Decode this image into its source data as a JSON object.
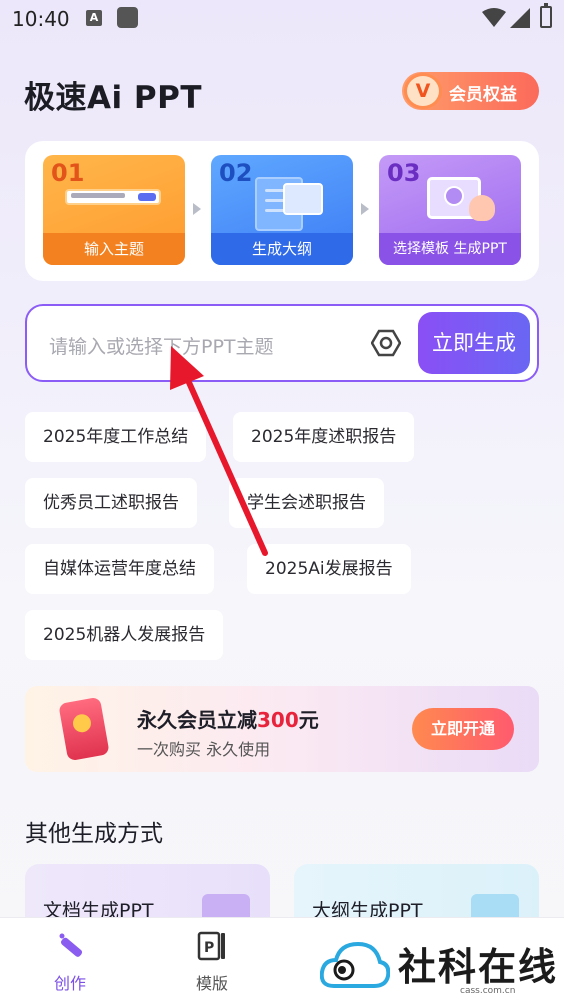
{
  "status_bar": {
    "time": "10:40",
    "notif_letter": "A"
  },
  "header": {
    "title": "极速Ai PPT",
    "vip_badge": "V",
    "vip_label": "会员权益"
  },
  "steps": [
    {
      "num": "01",
      "label": "输入主题"
    },
    {
      "num": "02",
      "label": "生成大纲"
    },
    {
      "num": "03",
      "label": "选择模板 生成PPT"
    }
  ],
  "topic_input": {
    "placeholder": "请输入或选择下方PPT主题",
    "generate_label": "立即生成"
  },
  "topics": [
    "2025年度工作总结",
    "2025年度述职报告",
    "优秀员工述职报告",
    "学生会述职报告",
    "自媒体运营年度总结",
    "2025Ai发展报告",
    "2025机器人发展报告"
  ],
  "promo": {
    "title_prefix": "永久会员立减",
    "amount": "300",
    "title_suffix": "元",
    "subtitle": "一次购买 永久使用",
    "button": "立即开通"
  },
  "other_methods": {
    "heading": "其他生成方式",
    "items": [
      {
        "label": "文档生成PPT"
      },
      {
        "label": "大纲生成PPT"
      }
    ]
  },
  "bottom_nav": {
    "items": [
      {
        "label": "创作",
        "active": true
      },
      {
        "label": "模版",
        "active": false
      }
    ]
  },
  "watermark": {
    "text": "社科在线",
    "url": "cass.com.cn"
  },
  "colors": {
    "accent": "#8b5cf6",
    "arrow": "#e8182c",
    "vip": "#fb6a5a"
  }
}
